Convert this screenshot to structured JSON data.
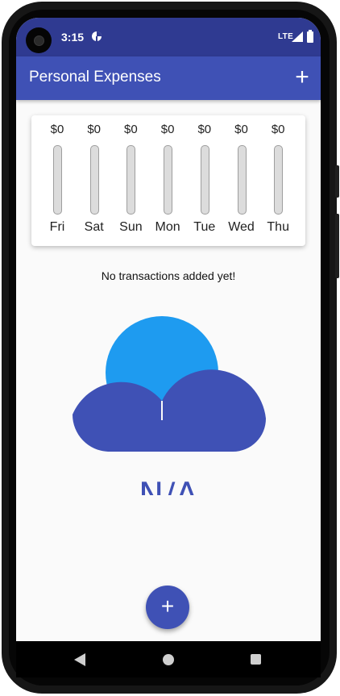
{
  "status_bar": {
    "time": "3:15",
    "network": "LTE",
    "icons": [
      "camera-icon",
      "app-notification-icon",
      "signal-icon",
      "battery-icon"
    ]
  },
  "app_bar": {
    "title": "Personal Expenses",
    "add_icon": "plus-icon",
    "add_label": "+"
  },
  "chart": {
    "days": [
      {
        "label": "Fri",
        "amount": "$0",
        "fill": 0
      },
      {
        "label": "Sat",
        "amount": "$0",
        "fill": 0
      },
      {
        "label": "Sun",
        "amount": "$0",
        "fill": 0
      },
      {
        "label": "Mon",
        "amount": "$0",
        "fill": 0
      },
      {
        "label": "Tue",
        "amount": "$0",
        "fill": 0
      },
      {
        "label": "Wed",
        "amount": "$0",
        "fill": 0
      },
      {
        "label": "Thu",
        "amount": "$0",
        "fill": 0
      }
    ]
  },
  "empty_state": {
    "message": "No transactions added yet!",
    "image_text": "N/A"
  },
  "fab": {
    "icon": "plus-icon",
    "label": "+"
  },
  "nav_bar": {
    "icons": [
      "back-icon",
      "home-icon",
      "recents-icon"
    ]
  },
  "colors": {
    "primary": "#3f51b5",
    "status_bar": "#2f3a91",
    "cloud_light": "#1e9bf0",
    "cloud_dark": "#3f51b5",
    "background": "#fafafa"
  }
}
